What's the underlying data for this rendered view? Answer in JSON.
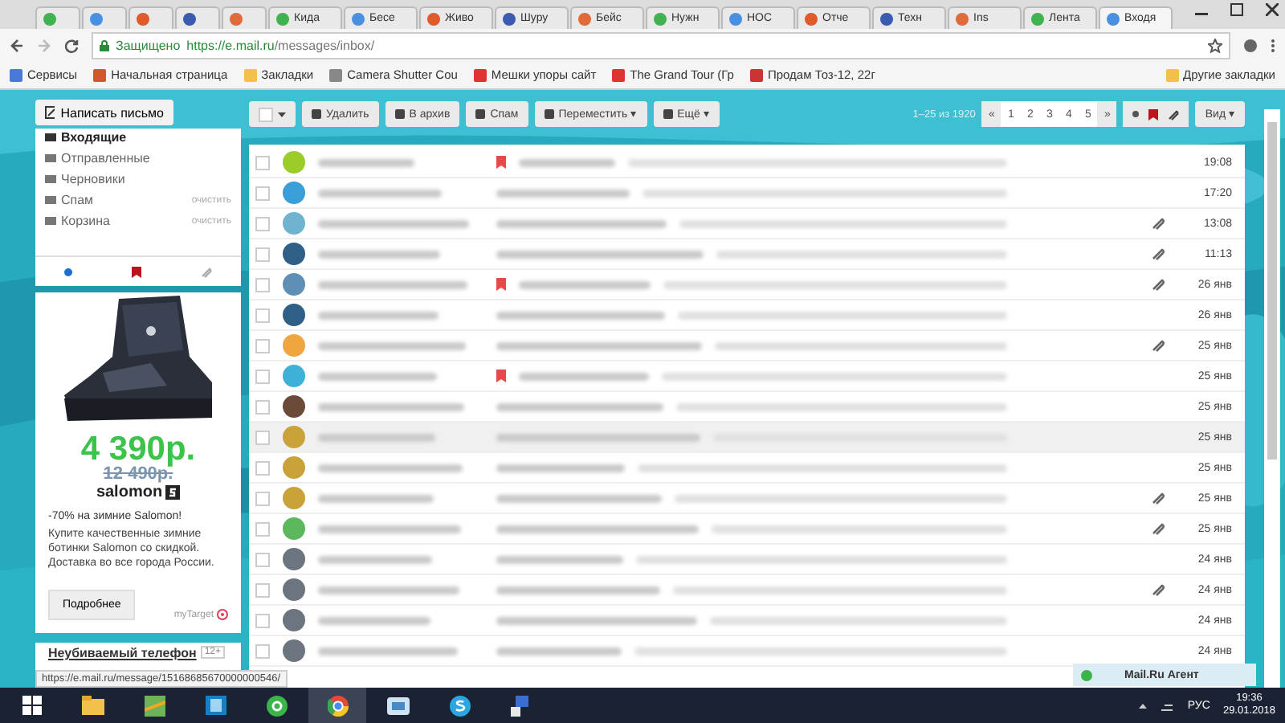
{
  "browser": {
    "tabs": [
      {
        "selected": false
      },
      {
        "selected": false
      },
      {
        "selected": false
      },
      {
        "selected": false
      },
      {
        "selected": false
      },
      {
        "label": "Кида",
        "selected": false
      },
      {
        "label": "Бесе",
        "selected": false
      },
      {
        "label": "Живо",
        "selected": false
      },
      {
        "label": "Шуру",
        "selected": false
      },
      {
        "label": "Бейс",
        "selected": false
      },
      {
        "label": "Нужн",
        "selected": false
      },
      {
        "label": "НОС",
        "selected": false
      },
      {
        "label": "Отче",
        "selected": false
      },
      {
        "label": "Техн",
        "selected": false
      },
      {
        "label": "Ins",
        "selected": false
      },
      {
        "label": "Лента",
        "selected": false
      },
      {
        "label": "Входя",
        "selected": true
      }
    ],
    "security": "Защищено",
    "url_host": "https://e.mail.ru",
    "url_path": "/messages/inbox/",
    "bookmarks": [
      "Сервисы",
      "Начальная страница",
      "Закладки",
      "Camera Shutter Cou",
      "Мешки упоры сайт",
      "The Grand Tour (Гр",
      "Продам Тоз-12, 22г"
    ],
    "other_bookmarks": "Другие закладки"
  },
  "compose": "Написать письмо",
  "folders": [
    {
      "label": "Входящие",
      "selected": true
    },
    {
      "label": "Отправленные",
      "selected": false
    },
    {
      "label": "Черновики",
      "selected": false
    },
    {
      "label": "Спам",
      "action": "очистить",
      "selected": false
    },
    {
      "label": "Корзина",
      "action": "очистить",
      "selected": false
    }
  ],
  "ad": {
    "price": "4 390р.",
    "old_price": "12 490р.",
    "brand": "salomon",
    "headline": "-70% на зимние Salomon!",
    "text": "Купите качественные зимние ботинки Salomon со скидкой. Доставка во все города России.",
    "button": "Подробнее",
    "network": "myTarget"
  },
  "next_ad": {
    "title": "Неубиваемый телефон",
    "age": "12+"
  },
  "toolbar": {
    "buttons": [
      "Удалить",
      "В архив",
      "Спам",
      "Переместить ▾",
      "Ещё ▾"
    ],
    "range": "1–25 из 1920",
    "pages": [
      "«",
      "1",
      "2",
      "3",
      "4",
      "5",
      "»"
    ],
    "view": "Вид ▾"
  },
  "messages": [
    {
      "date": "19:08",
      "color": "#9ccc2a",
      "attachment": false,
      "important": true,
      "selected": false
    },
    {
      "date": "17:20",
      "color": "#3a9fd8",
      "attachment": false,
      "important": false,
      "selected": false
    },
    {
      "date": "13:08",
      "color": "#6fb3d0",
      "attachment": true,
      "important": false,
      "selected": false
    },
    {
      "date": "11:13",
      "color": "#2f5f86",
      "attachment": true,
      "important": false,
      "selected": false
    },
    {
      "date": "26 янв",
      "color": "#5f8fb5",
      "attachment": true,
      "important": true,
      "selected": false
    },
    {
      "date": "26 янв",
      "color": "#2f5f86",
      "attachment": false,
      "important": false,
      "selected": false
    },
    {
      "date": "25 янв",
      "color": "#f0a640",
      "attachment": true,
      "important": false,
      "selected": false
    },
    {
      "date": "25 янв",
      "color": "#3fb0d8",
      "attachment": false,
      "important": true,
      "selected": false
    },
    {
      "date": "25 янв",
      "color": "#6b4a3a",
      "attachment": false,
      "important": false,
      "selected": false
    },
    {
      "date": "25 янв",
      "color": "#c9a23a",
      "attachment": false,
      "important": false,
      "selected": true
    },
    {
      "date": "25 янв",
      "color": "#c9a23a",
      "attachment": false,
      "important": false,
      "selected": false
    },
    {
      "date": "25 янв",
      "color": "#c9a23a",
      "attachment": true,
      "important": false,
      "selected": false
    },
    {
      "date": "25 янв",
      "color": "#5cb85c",
      "attachment": true,
      "important": false,
      "selected": false
    },
    {
      "date": "24 янв",
      "color": "#6a7580",
      "attachment": false,
      "important": false,
      "selected": false
    },
    {
      "date": "24 янв",
      "color": "#6a7580",
      "attachment": true,
      "important": false,
      "selected": false
    },
    {
      "date": "24 янв",
      "color": "#6a7580",
      "attachment": false,
      "important": false,
      "selected": false
    },
    {
      "date": "24 янв",
      "color": "#6a7580",
      "attachment": false,
      "important": false,
      "selected": false
    }
  ],
  "status_url": "https://e.mail.ru/message/15168685670000000546/",
  "agent": "Mail.Ru Агент",
  "taskbar": {
    "language": "РУС",
    "time": "19:36",
    "date": "29.01.2018"
  }
}
